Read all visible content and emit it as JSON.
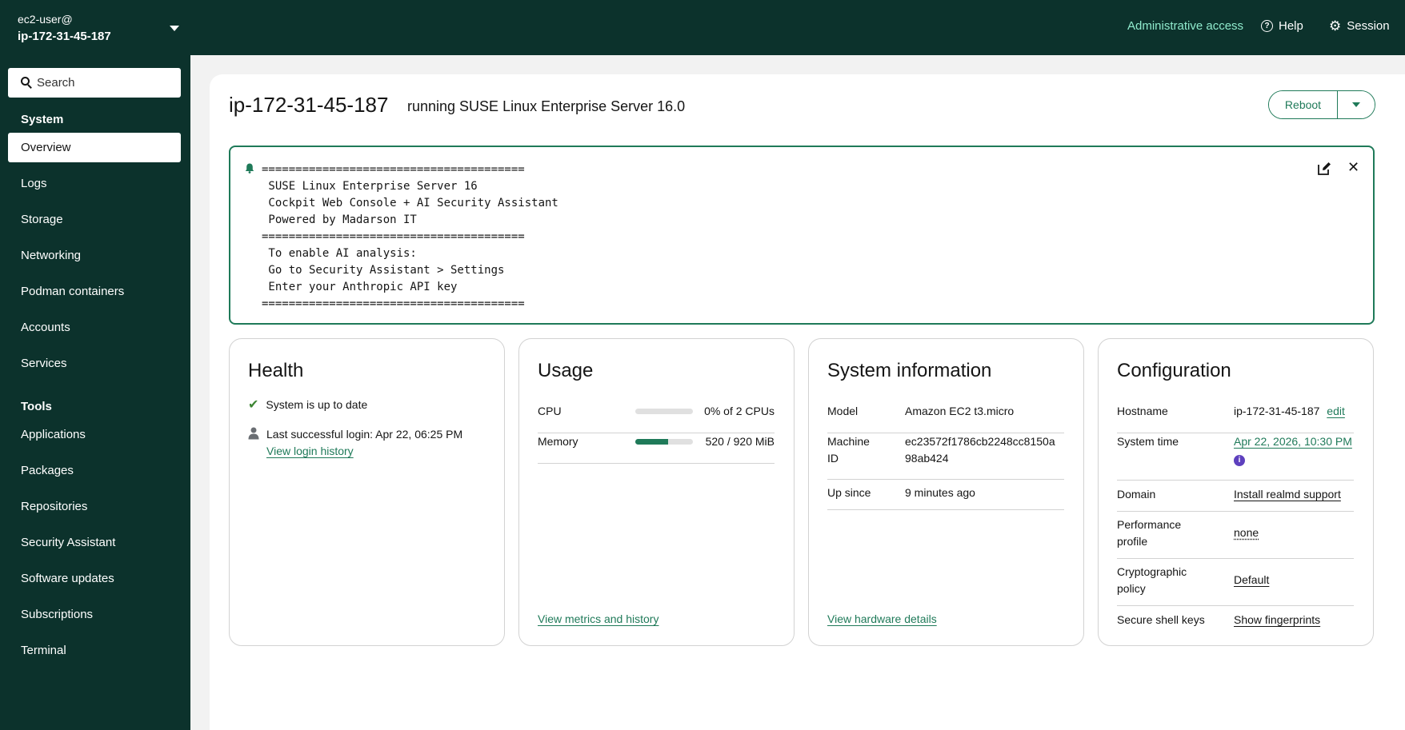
{
  "topbar": {
    "host_user": "ec2-user@",
    "host_name": "ip-172-31-45-187",
    "admin_access": "Administrative access",
    "help": "Help",
    "session": "Session"
  },
  "sidebar": {
    "search_placeholder": "Search",
    "section_system": "System",
    "section_tools": "Tools",
    "system_items": [
      "Overview",
      "Logs",
      "Storage",
      "Networking",
      "Podman containers",
      "Accounts",
      "Services"
    ],
    "tools_items": [
      "Applications",
      "Packages",
      "Repositories",
      "Security Assistant",
      "Software updates",
      "Subscriptions",
      "Terminal"
    ]
  },
  "header": {
    "title": "ip-172-31-45-187",
    "subtitle": "running SUSE Linux Enterprise Server 16.0",
    "reboot": "Reboot"
  },
  "motd": {
    "text": "=======================================\n SUSE Linux Enterprise Server 16\n Cockpit Web Console + AI Security Assistant\n Powered by Madarson IT\n=======================================\n To enable AI analysis:\n Go to Security Assistant > Settings\n Enter your Anthropic API key\n======================================="
  },
  "health": {
    "title": "Health",
    "status": "System is up to date",
    "last_login": "Last successful login: Apr 22, 06:25 PM",
    "login_history_link": "View login history"
  },
  "usage": {
    "title": "Usage",
    "cpu_label": "CPU",
    "cpu_value": "0% of 2 CPUs",
    "cpu_fraction": 0.0,
    "memory_label": "Memory",
    "memory_value": "520 / 920 MiB",
    "memory_fraction": 0.565,
    "metrics_link": "View metrics and history"
  },
  "sysinfo": {
    "title": "System information",
    "model_label": "Model",
    "model_value": "Amazon EC2 t3.micro",
    "machine_id_label_1": "Machine",
    "machine_id_label_2": "ID",
    "machine_id_value_1": "ec23572f1786cb2248cc8150a",
    "machine_id_value_2": "98ab424",
    "up_since_label": "Up since",
    "up_since_value": "9 minutes ago",
    "hardware_link": "View hardware details"
  },
  "config": {
    "title": "Configuration",
    "hostname_label": "Hostname",
    "hostname_value": "ip-172-31-45-187",
    "hostname_edit": "edit",
    "time_label": "System time",
    "time_value": "Apr 22, 2026, 10:30 PM",
    "domain_label": "Domain",
    "domain_value": "Install realmd support",
    "perf_label_1": "Performance",
    "perf_label_2": "profile",
    "perf_value": "none",
    "crypto_label_1": "Cryptographic",
    "crypto_label_2": "policy",
    "crypto_value": "Default",
    "ssh_label": "Secure shell keys",
    "ssh_value": "Show fingerprints"
  }
}
